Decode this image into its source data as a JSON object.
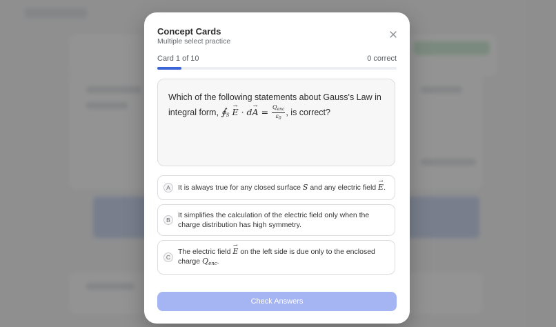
{
  "modal": {
    "title": "Concept Cards",
    "subtitle": "Multiple select practice",
    "close_icon": "close-icon"
  },
  "progress": {
    "label": "Card 1 of 10",
    "current": 1,
    "total": 10,
    "correct_label": "0 correct",
    "fill_color": "#3a63d8"
  },
  "question": {
    "text_before": "Which of the following statements about Gauss's Law in integral form,",
    "formula": "∮S E · dA = Qenc/ε0",
    "formula_lhs": "∮",
    "formula_S": "S",
    "formula_E": "E",
    "formula_dot": " · d",
    "formula_A": "A",
    "formula_eq": " = ",
    "formula_num": "Q",
    "formula_num_sub": "enc",
    "formula_den": "ε",
    "formula_den_sub": "0",
    "text_after": ", is correct?"
  },
  "options": [
    {
      "letter": "A",
      "text_1": "It is always true for any closed surface",
      "math_1": "S",
      "text_2": "and any electric field",
      "math_2": "E",
      "text_3": "."
    },
    {
      "letter": "B",
      "text": "It simplifies the calculation of the electric field only when the charge distribution has high symmetry."
    },
    {
      "letter": "C",
      "text_1": "The electric field",
      "math_1": "E",
      "text_2": "on the left side is due only to the enclosed charge",
      "math_2": "Q",
      "math_2_sub": "enc",
      "text_3": "."
    }
  ],
  "actions": {
    "check_label": "Check Answers",
    "check_color": "#a5b4f3"
  }
}
